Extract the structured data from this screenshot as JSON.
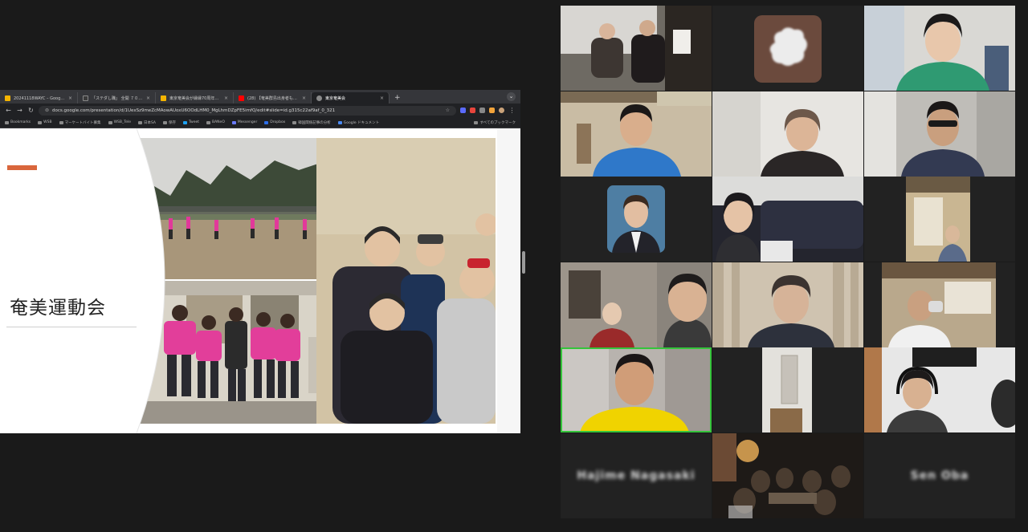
{
  "browser": {
    "tabs": [
      {
        "title": "20241118WAYC – Google スラ",
        "favicon_color": "#f4b400",
        "active": false
      },
      {
        "title": "「ステダし職」 全開 ７００人に",
        "favicon_color": "#3a3a3a",
        "active": false
      },
      {
        "title": "東京奄美会が縁縁70周年式典・",
        "favicon_color": "#f4b400",
        "active": false
      },
      {
        "title": "(28) 【奄美群島出身者も吹ら】",
        "favicon_color": "#ff0000",
        "active": false
      },
      {
        "title": "東京奄美会",
        "favicon_color": "#8a8a8a",
        "active": true
      }
    ],
    "new_tab": "+",
    "url": "docs.google.com/presentation/d/1UexSz9meZcMAowAUoxU6OOdLHM0_MgLhmDZpFE5imfQ/edit#slide=id.g315c22af9af_0_321",
    "bookmarks": [
      "Bookmarks",
      "WSB",
      "マーケートバイト募集",
      "WSB_Tele",
      "日本SA",
      "保存",
      "Tweet",
      "BANeO",
      "Messenger",
      "Dropbox",
      "韓国関係記事の分析",
      "Google ドキュメント"
    ],
    "all_bookmarks": "すべてのブックマーク"
  },
  "slide": {
    "title": "奄美運動会",
    "accent_color": "#d9663c"
  },
  "participants": [
    {
      "id": "p1",
      "kind": "video"
    },
    {
      "id": "p2",
      "kind": "avatar"
    },
    {
      "id": "p3",
      "kind": "video"
    },
    {
      "id": "p4",
      "kind": "video"
    },
    {
      "id": "p5",
      "kind": "video"
    },
    {
      "id": "p6",
      "kind": "video"
    },
    {
      "id": "p7",
      "kind": "avatar"
    },
    {
      "id": "p8",
      "kind": "video"
    },
    {
      "id": "p9",
      "kind": "video"
    },
    {
      "id": "p10",
      "kind": "video"
    },
    {
      "id": "p11",
      "kind": "video"
    },
    {
      "id": "p12",
      "kind": "video"
    },
    {
      "id": "p13",
      "kind": "video",
      "active_speaker": true
    },
    {
      "id": "p14",
      "kind": "video"
    },
    {
      "id": "p15",
      "kind": "video"
    },
    {
      "id": "p16",
      "kind": "name",
      "name": "Hajime Nagasaki"
    },
    {
      "id": "p17",
      "kind": "video"
    },
    {
      "id": "p18",
      "kind": "name",
      "name": "Sen Oba"
    }
  ],
  "colors": {
    "active_speaker_border": "#35c43b",
    "background": "#1a1a1a"
  }
}
